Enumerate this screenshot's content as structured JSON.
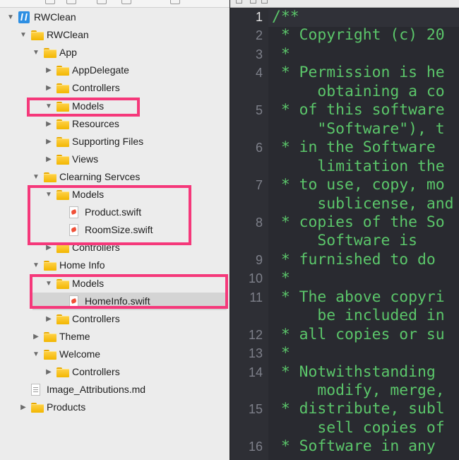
{
  "navigator": {
    "rows": [
      {
        "label": "RWClean",
        "icon": "project-icon",
        "expanded": true
      },
      {
        "label": "RWClean",
        "icon": "folder-icon",
        "expanded": true
      },
      {
        "label": "App",
        "icon": "folder-icon",
        "expanded": true
      },
      {
        "label": "AppDelegate",
        "icon": "folder-icon",
        "expanded": false
      },
      {
        "label": "Controllers",
        "icon": "folder-icon",
        "expanded": false
      },
      {
        "label": "Models",
        "icon": "folder-icon",
        "expanded": true
      },
      {
        "label": "Resources",
        "icon": "folder-icon",
        "expanded": false
      },
      {
        "label": "Supporting Files",
        "icon": "folder-icon",
        "expanded": false
      },
      {
        "label": "Views",
        "icon": "folder-icon",
        "expanded": false
      },
      {
        "label": "Clearning Servces",
        "icon": "folder-icon",
        "expanded": true
      },
      {
        "label": "Models",
        "icon": "folder-icon",
        "expanded": true
      },
      {
        "label": "Product.swift",
        "icon": "swift-file-icon"
      },
      {
        "label": "RoomSize.swift",
        "icon": "swift-file-icon"
      },
      {
        "label": "Controllers",
        "icon": "folder-icon",
        "expanded": false
      },
      {
        "label": "Home Info",
        "icon": "folder-icon",
        "expanded": true
      },
      {
        "label": "Models",
        "icon": "folder-icon",
        "expanded": true
      },
      {
        "label": "HomeInfo.swift",
        "icon": "swift-file-icon",
        "selected": true
      },
      {
        "label": "Controllers",
        "icon": "folder-icon",
        "expanded": false
      },
      {
        "label": "Theme",
        "icon": "folder-icon",
        "expanded": false
      },
      {
        "label": "Welcome",
        "icon": "folder-icon",
        "expanded": true
      },
      {
        "label": "Controllers",
        "icon": "folder-icon",
        "expanded": false
      },
      {
        "label": "Image_Attributions.md",
        "icon": "markdown-file-icon"
      },
      {
        "label": "Products",
        "icon": "folder-icon",
        "expanded": false
      }
    ]
  },
  "editor": {
    "current_line": "1",
    "lines": [
      {
        "num": "1",
        "text": "/**"
      },
      {
        "num": "2",
        "text": " * Copyright (c) 20"
      },
      {
        "num": "3",
        "text": " *"
      },
      {
        "num": "4",
        "text": " * Permission is he"
      },
      {
        "num": "",
        "text": "     obtaining a co"
      },
      {
        "num": "5",
        "text": " * of this software"
      },
      {
        "num": "",
        "text": "     \"Software\"), t"
      },
      {
        "num": "6",
        "text": " * in the Software "
      },
      {
        "num": "",
        "text": "     limitation the"
      },
      {
        "num": "7",
        "text": " * to use, copy, mo"
      },
      {
        "num": "",
        "text": "     sublicense, and"
      },
      {
        "num": "8",
        "text": " * copies of the So"
      },
      {
        "num": "",
        "text": "     Software is"
      },
      {
        "num": "9",
        "text": " * furnished to do "
      },
      {
        "num": "10",
        "text": " *"
      },
      {
        "num": "11",
        "text": " * The above copyri"
      },
      {
        "num": "",
        "text": "     be included in"
      },
      {
        "num": "12",
        "text": " * all copies or su"
      },
      {
        "num": "13",
        "text": " *"
      },
      {
        "num": "14",
        "text": " * Notwithstanding "
      },
      {
        "num": "",
        "text": "     modify, merge,"
      },
      {
        "num": "15",
        "text": " * distribute, subl"
      },
      {
        "num": "",
        "text": "     sell copies of"
      },
      {
        "num": "16",
        "text": " * Software in any "
      }
    ]
  },
  "colors": {
    "editor_background": "#292a30",
    "comment_text": "#5bc66a",
    "line_number": "#7e808a",
    "highlight_box": "#f5387a",
    "folder": "#f2b600",
    "selection": "#d4d4d4"
  }
}
